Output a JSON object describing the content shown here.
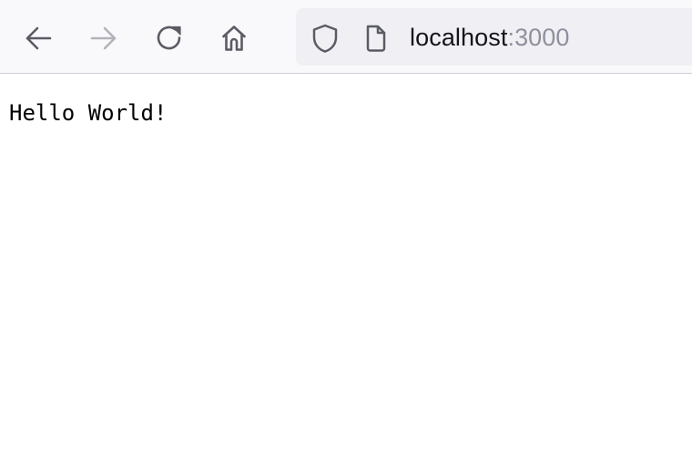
{
  "toolbar": {
    "back": {
      "icon": "arrow-left-icon",
      "enabled": true
    },
    "forward": {
      "icon": "arrow-right-icon",
      "enabled": false
    },
    "reload": {
      "icon": "reload-icon"
    },
    "home": {
      "icon": "home-icon"
    }
  },
  "urlbar": {
    "security_icon": "shield-icon",
    "page_icon": "page-icon",
    "host": "localhost",
    "port": ":3000"
  },
  "page": {
    "body_text": "Hello World!"
  },
  "colors": {
    "toolbar_bg": "#f9f9fb",
    "urlbar_bg": "#f0f0f4",
    "icon": "#5b5b66",
    "icon_disabled": "#b3b3bb",
    "host_text": "#15141a",
    "port_text": "#8f8f9d"
  }
}
